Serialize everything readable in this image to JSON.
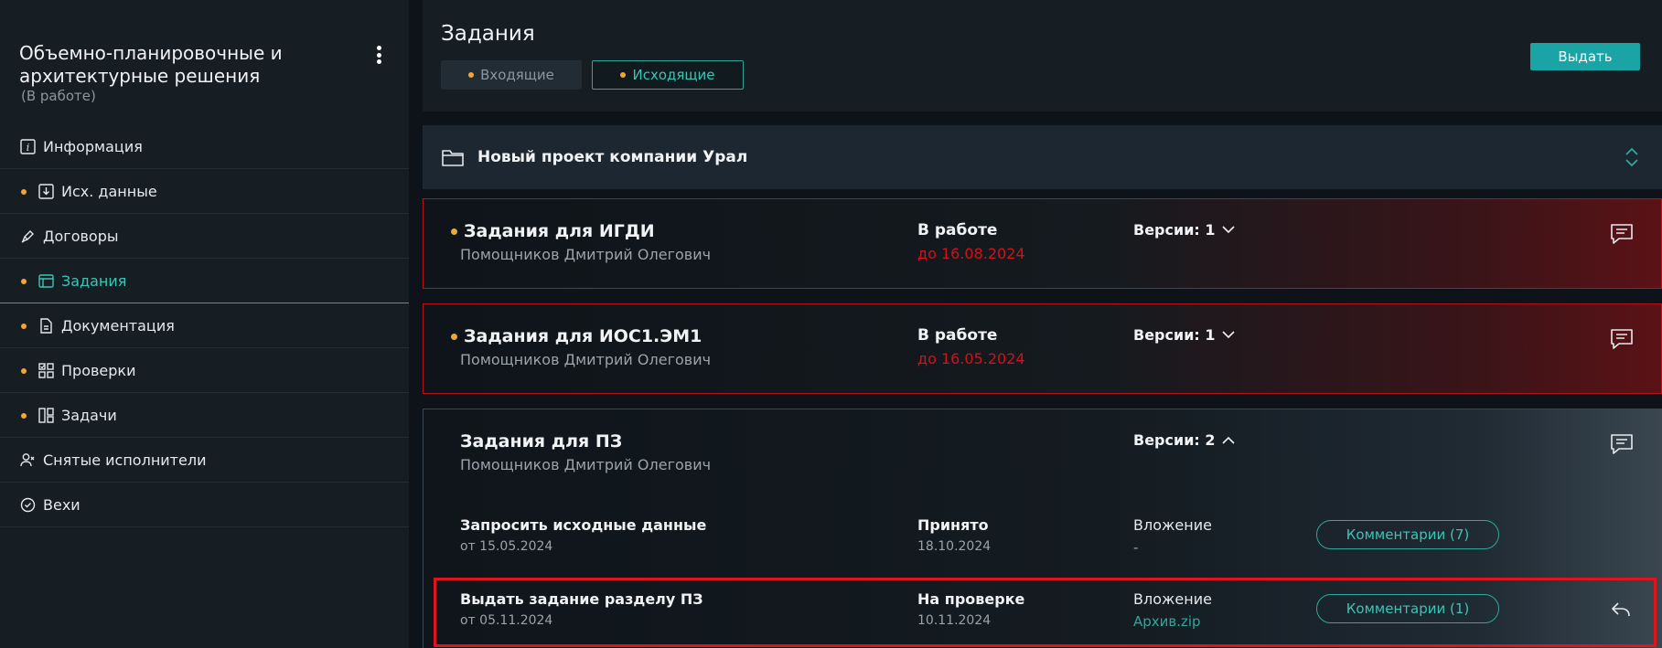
{
  "sidebar": {
    "title": "Объемно-планировочные и архитектурные решения",
    "status": "(В работе)",
    "items": [
      {
        "label": "Информация",
        "icon": "info-icon",
        "dot": false,
        "active": false
      },
      {
        "label": "Исх. данные",
        "icon": "download-icon",
        "dot": true,
        "active": false
      },
      {
        "label": "Договоры",
        "icon": "pen-icon",
        "dot": false,
        "active": false
      },
      {
        "label": "Задания",
        "icon": "window-icon",
        "dot": true,
        "active": true
      },
      {
        "label": "Документация",
        "icon": "document-icon",
        "dot": true,
        "active": false
      },
      {
        "label": "Проверки",
        "icon": "grid-check-icon",
        "dot": true,
        "active": false
      },
      {
        "label": "Задачи",
        "icon": "board-icon",
        "dot": true,
        "active": false
      },
      {
        "label": "Снятые исполнители",
        "icon": "user-remove-icon",
        "dot": false,
        "active": false
      },
      {
        "label": "Вехи",
        "icon": "check-circle-icon",
        "dot": false,
        "active": false
      }
    ]
  },
  "header": {
    "title": "Задания",
    "tabs": {
      "incoming": "Входящие",
      "outgoing": "Исходящие"
    },
    "issue_button": "Выдать"
  },
  "project": {
    "name": "Новый проект компании Урал"
  },
  "cards": [
    {
      "title": "Задания для ИГДИ",
      "author": "Помощников Дмитрий Олегович",
      "status": "В работе",
      "deadline": "до 16.08.2024",
      "versions": "Версии: 1"
    },
    {
      "title": "Задания для ИОС1.ЭМ1",
      "author": "Помощников Дмитрий Олегович",
      "status": "В работе",
      "deadline": "до 16.05.2024",
      "versions": "Версии: 1"
    },
    {
      "title": "Задания для ПЗ",
      "author": "Помощников Дмитрий Олегович",
      "versions": "Версии: 2",
      "rows": [
        {
          "title": "Запросить исходные данные",
          "date": "от 15.05.2024",
          "status": "Принято",
          "status_date": "18.10.2024",
          "attachment_label": "Вложение",
          "attachment": "-",
          "comments": "Комментарии (7)"
        },
        {
          "title": "Выдать задание разделу ПЗ",
          "date": "от 05.11.2024",
          "status": "На проверке",
          "status_date": "10.11.2024",
          "attachment_label": "Вложение",
          "attachment": "Архив.zip",
          "comments": "Комментарии (1)"
        }
      ]
    }
  ],
  "colors": {
    "accent": "#2fa89b",
    "dot": "#f0a733",
    "overdue": "#d0121a",
    "highlight": "#e0141c"
  }
}
